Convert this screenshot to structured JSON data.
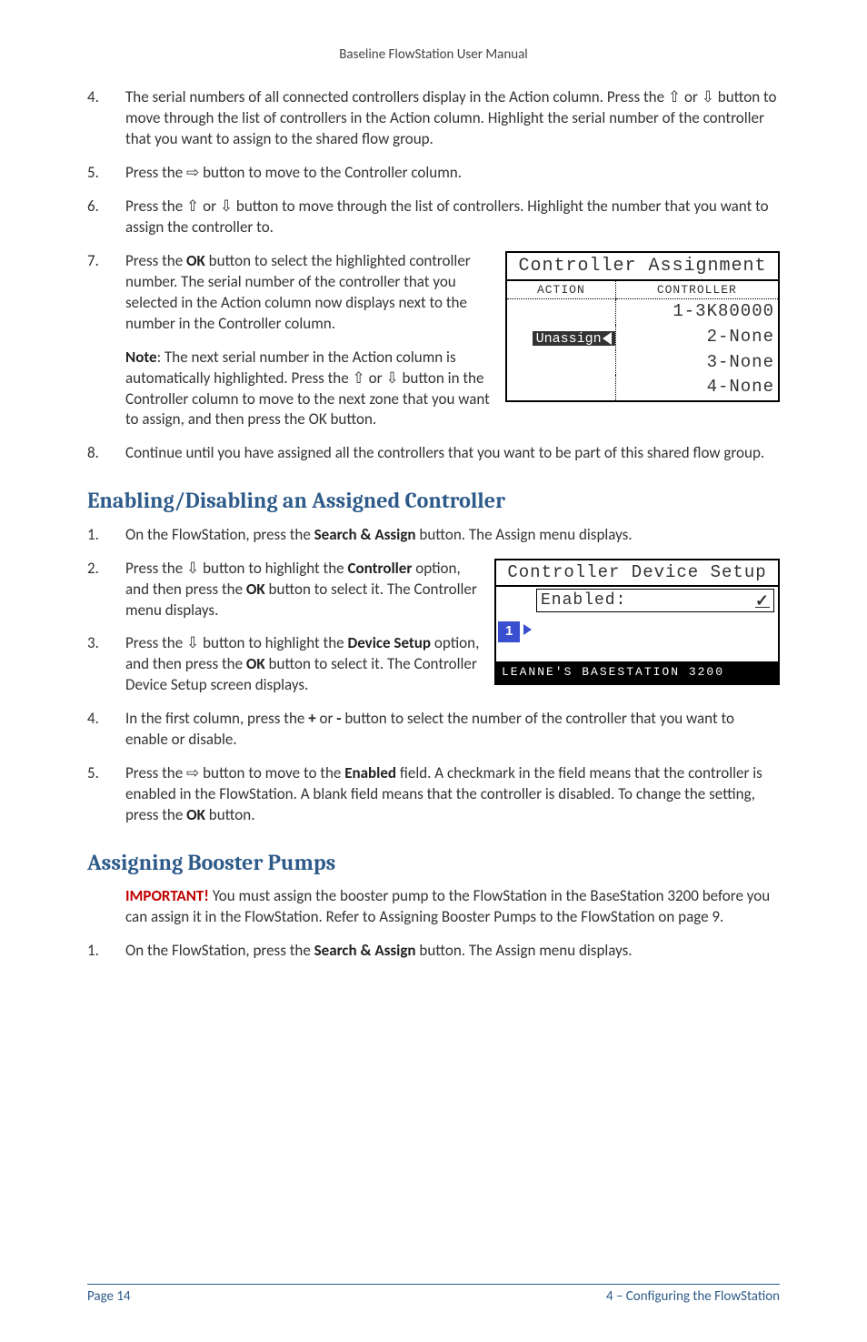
{
  "header": {
    "title": "Baseline FlowStation User Manual"
  },
  "arrows": {
    "up": "⇧",
    "down": "⇩",
    "right": "⇨"
  },
  "steps_a": {
    "s4": {
      "num": "4.",
      "text_a": "The serial numbers of all connected controllers display in the Action column. Press the ",
      "text_b": " or ",
      "text_c": " button to move through the list of controllers in the Action column. Highlight the serial number of the controller that you want to assign to the shared flow group."
    },
    "s5": {
      "num": "5.",
      "text_a": "Press the ",
      "text_b": " button to move to the Controller column."
    },
    "s6": {
      "num": "6.",
      "text_a": "Press the ",
      "text_b": " or ",
      "text_c": " button to move through the list of controllers. Highlight the number that you want to assign the controller to."
    },
    "s7": {
      "num": "7.",
      "text_a": "Press the ",
      "ok": "OK",
      "text_b": " button to select the highlighted controller number. The serial number of the controller that you selected in the Action column now displays next to the number in the Controller column."
    },
    "note": {
      "label": "Note",
      "text_a": ": The next serial number in the Action column is automatically highlighted. Press the ",
      "text_b": " or ",
      "text_c": " button in the Controller column to move to the next zone that you want to assign, and then press the OK button."
    },
    "s8": {
      "num": "8.",
      "text": "Continue until you have assigned all the controllers that you want to be part of this shared flow group."
    }
  },
  "fig1": {
    "title": "Controller Assignment",
    "hdr_left": "ACTION",
    "hdr_right": "CONTROLLER",
    "rows": {
      "r1_left": "",
      "r1_right": "1-3K80000",
      "r2_left": "Unassign",
      "r2_right": "2-None",
      "r3_left": "",
      "r3_right": "3-None",
      "r4_left": "",
      "r4_right": "4-None"
    }
  },
  "sec1": {
    "title": "Enabling/Disabling an Assigned Controller"
  },
  "steps_b": {
    "s1": {
      "num": "1.",
      "text_a": "On the FlowStation, press the ",
      "btn": "Search & Assign",
      "text_b": " button. The Assign menu displays."
    },
    "s2": {
      "num": "2.",
      "text_a": "Press the ",
      "text_b": " button to highlight the ",
      "ctrl": "Controller",
      "text_c": " option, and then press the ",
      "ok": "OK",
      "text_d": " button to select it. The Controller menu displays."
    },
    "s3": {
      "num": "3.",
      "text_a": "Press the ",
      "text_b": " button to highlight the ",
      "dev": "Device Setup",
      "text_c": " option, and then press the ",
      "ok": "OK",
      "text_d": " button to select it. The Controller Device Setup screen displays."
    },
    "s4": {
      "num": "4.",
      "text_a": "In the first column, press the ",
      "plus": "+",
      "text_b": " or ",
      "minus": "-",
      "text_c": " button to select the number of the controller that you want to enable or disable."
    },
    "s5": {
      "num": "5.",
      "text_a": "Press the ",
      "text_b": " button to move to the ",
      "enabled": "Enabled",
      "text_c": " field. A checkmark in the field means that the controller is enabled in the FlowStation. A blank field means that the controller is disabled. To change the setting, press the ",
      "ok": "OK",
      "text_d": " button."
    }
  },
  "fig2": {
    "title": "Controller Device Setup",
    "enabled_label": "Enabled:",
    "check": "✓",
    "num": "1",
    "status": "LEANNE'S BASESTATION 3200"
  },
  "sec2": {
    "title": "Assigning Booster Pumps"
  },
  "important": {
    "label": "IMPORTANT!",
    "text": " You must assign the booster pump to the FlowStation in the BaseStation 3200 before you can assign it in the FlowStation. Refer to Assigning Booster Pumps to the FlowStation on page 9."
  },
  "steps_c": {
    "s1": {
      "num": "1.",
      "text_a": "On the FlowStation, press the ",
      "btn": "Search & Assign",
      "text_b": " button. The Assign menu displays."
    }
  },
  "footer": {
    "left": "Page 14",
    "right": "4 – Configuring the FlowStation"
  }
}
